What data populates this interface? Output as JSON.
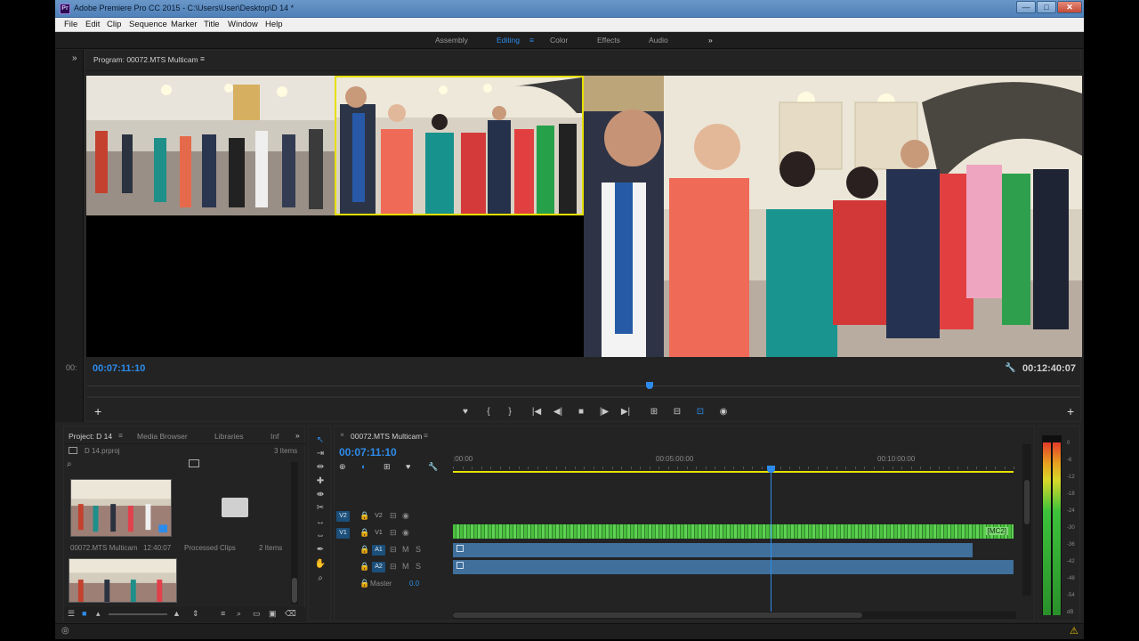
{
  "window": {
    "title": "Adobe Premiere Pro CC 2015 - C:\\Users\\User\\Desktop\\D 14 *",
    "logo_text": "Pr",
    "controls": [
      "—",
      "□",
      "✕"
    ]
  },
  "menu": [
    "File",
    "Edit",
    "Clip",
    "Sequence",
    "Marker",
    "Title",
    "Window",
    "Help"
  ],
  "workspaces": {
    "items": [
      "Assembly",
      "Editing",
      "Color",
      "Effects",
      "Audio"
    ],
    "active": "Editing",
    "more": "»"
  },
  "program_monitor": {
    "expand": "»",
    "title": "Program: 00072.MTS Multicam",
    "menu_glyph": "≡",
    "timecode_left": "00:07:11:10",
    "timecode_right": "00:12:40:07",
    "source_tc_stub": "00:",
    "add_button": "+",
    "wrench": "🔧"
  },
  "transport": [
    {
      "name": "add-marker-button",
      "glyph": "♥"
    },
    {
      "name": "mark-in-button",
      "glyph": "{"
    },
    {
      "name": "mark-out-button",
      "glyph": "}"
    },
    {
      "name": "go-to-in-button",
      "glyph": "|◀"
    },
    {
      "name": "step-back-button",
      "glyph": "◀|"
    },
    {
      "name": "stop-button",
      "glyph": "■"
    },
    {
      "name": "step-forward-button",
      "glyph": "|▶"
    },
    {
      "name": "go-to-out-button",
      "glyph": "▶|"
    },
    {
      "name": "lift-button",
      "glyph": "⊞"
    },
    {
      "name": "extract-button",
      "glyph": "⊟"
    },
    {
      "name": "multicam-button",
      "glyph": "⊡"
    },
    {
      "name": "export-frame-button",
      "glyph": "◉"
    }
  ],
  "project_panel": {
    "tabs": [
      "Project: D 14",
      "Media Browser",
      "Libraries",
      "Inf"
    ],
    "tab_menu": "≡",
    "more": "»",
    "project_file": "D 14.prproj",
    "item_count": "3 Items",
    "items": [
      {
        "name": "00072.MTS Multicam",
        "duration": "12:40:07"
      },
      {
        "name": "Processed Clips",
        "duration": "2 Items"
      }
    ]
  },
  "timeline": {
    "close": "×",
    "title": "00072.MTS Multicam",
    "menu_glyph": "≡",
    "timecode": "00:07:11:10",
    "ruler": [
      ":00:00",
      "00:05:00:00",
      "00:10:00:00"
    ],
    "playhead_fraction": 0.566,
    "tracks": [
      {
        "id": "V2",
        "kind": "video"
      },
      {
        "id": "V1",
        "kind": "video"
      },
      {
        "id": "A1",
        "kind": "audio",
        "m": "M",
        "s": "S"
      },
      {
        "id": "A2",
        "kind": "audio",
        "m": "M",
        "s": "S"
      }
    ],
    "master": {
      "label": "Master",
      "value": "0.0"
    },
    "clip_label": "[MC2]"
  },
  "audio_meter": {
    "labels": [
      "0",
      "-6",
      "-12",
      "-18",
      "-24",
      "-30",
      "-36",
      "-42",
      "-48",
      "-54",
      "dB"
    ],
    "level_fraction": 0.96
  },
  "colors": {
    "accent": "#2d8ceb",
    "video_clip": "#4bbf3f",
    "audio_clip": "#3f6f9a",
    "playhead": "#2d8ceb",
    "work_area": "#e8e000"
  }
}
